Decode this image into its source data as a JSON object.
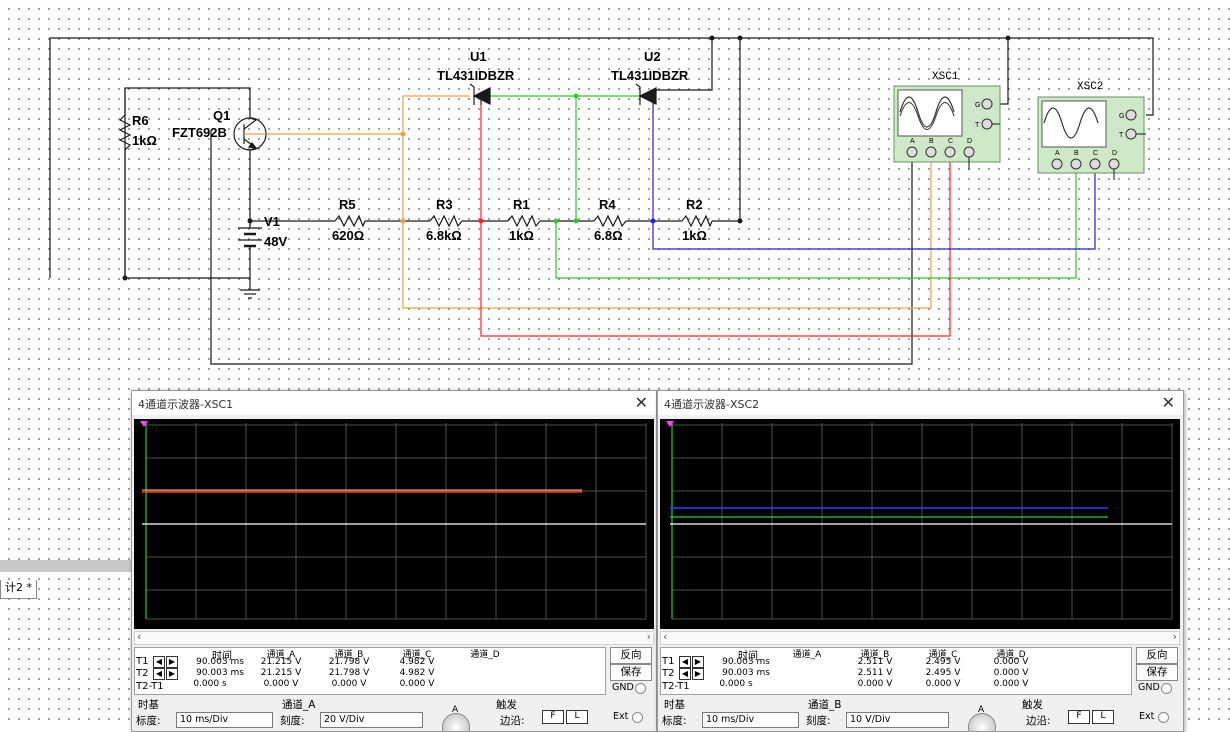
{
  "schematic": {
    "components": {
      "r6": {
        "name": "R6",
        "value": "1kΩ"
      },
      "q1": {
        "name": "Q1",
        "value": "FZT692B"
      },
      "u1": {
        "name": "U1",
        "value": "TL431IDBZR"
      },
      "u2": {
        "name": "U2",
        "value": "TL431IDBZR"
      },
      "v1": {
        "name": "V1",
        "value": "48V"
      },
      "r5": {
        "name": "R5",
        "value": "620Ω"
      },
      "r3": {
        "name": "R3",
        "value": "6.8kΩ"
      },
      "r1": {
        "name": "R1",
        "value": "1kΩ"
      },
      "r4": {
        "name": "R4",
        "value": "6.8Ω"
      },
      "r2": {
        "name": "R2",
        "value": "1kΩ"
      },
      "xsc1": {
        "name": "XSC1"
      },
      "xsc2": {
        "name": "XSC2"
      }
    },
    "pins": {
      "g": "G",
      "t": "T",
      "a": "A",
      "b": "B",
      "c": "C",
      "d": "D"
    },
    "wire_colors": {
      "black": "#1a1a1a",
      "orange": "#f0a040",
      "green": "#2ec82e",
      "red": "#ff2020",
      "blue": "#2020e0"
    }
  },
  "design_tab": "计2 *",
  "xsc1_window": {
    "title": "4通道示波器-XSC1",
    "close": "✕",
    "traces": {
      "a_color": "#ff3030",
      "b_color": "#ffcc44",
      "c_color": "#ffffff"
    },
    "headers": {
      "time": "时间",
      "a": "通道_A",
      "b": "通道_B",
      "c": "通道_C",
      "d": "通道_D"
    },
    "rows": {
      "t1": {
        "label": "T1",
        "time": "90.003 ms",
        "a": "21.215 V",
        "b": "21.798 V",
        "c": "4.982 V",
        "d": ""
      },
      "t2": {
        "label": "T2",
        "time": "90.003 ms",
        "a": "21.215 V",
        "b": "21.798 V",
        "c": "4.982 V",
        "d": ""
      },
      "diff": {
        "label": "T2-T1",
        "time": "0.000 s",
        "a": "0.000 V",
        "b": "0.000 V",
        "c": "0.000 V",
        "d": ""
      }
    },
    "buttons": {
      "reverse": "反向",
      "save": "保存",
      "gnd": "GND"
    },
    "timebase": {
      "section": "时基",
      "scale_label": "标度:",
      "scale": "10 ms/Div"
    },
    "channel": {
      "section": "通道_A",
      "scale_label": "刻度:",
      "scale": "20  V/Div",
      "knob_label": "A"
    },
    "trigger": {
      "section": "触发",
      "edge_label": "边沿:",
      "rise": "F",
      "fall": "L",
      "ext": "Ext"
    }
  },
  "xsc2_window": {
    "title": "4通道示波器-XSC2",
    "close": "✕",
    "traces": {
      "b_color": "#2ed42e",
      "c_color": "#3040ff",
      "d_color": "#ffffff"
    },
    "headers": {
      "time": "时间",
      "a": "通道_A",
      "b": "通道_B",
      "c": "通道_C",
      "d": "通道_D"
    },
    "rows": {
      "t1": {
        "label": "T1",
        "time": "90.003 ms",
        "a": "",
        "b": "2.511 V",
        "c": "2.495 V",
        "d": "0.000 V"
      },
      "t2": {
        "label": "T2",
        "time": "90.003 ms",
        "a": "",
        "b": "2.511 V",
        "c": "2.495 V",
        "d": "0.000 V"
      },
      "diff": {
        "label": "T2-T1",
        "time": "0.000 s",
        "a": "",
        "b": "0.000 V",
        "c": "0.000 V",
        "d": "0.000 V"
      }
    },
    "buttons": {
      "reverse": "反向",
      "save": "保存",
      "gnd": "GND"
    },
    "timebase": {
      "section": "时基",
      "scale_label": "标度:",
      "scale": "10 ms/Div"
    },
    "channel": {
      "section": "通道_B",
      "scale_label": "刻度:",
      "scale": "10  V/Div",
      "knob_label": "A"
    },
    "trigger": {
      "section": "触发",
      "edge_label": "边沿:",
      "rise": "F",
      "fall": "L",
      "ext": "Ext"
    }
  }
}
